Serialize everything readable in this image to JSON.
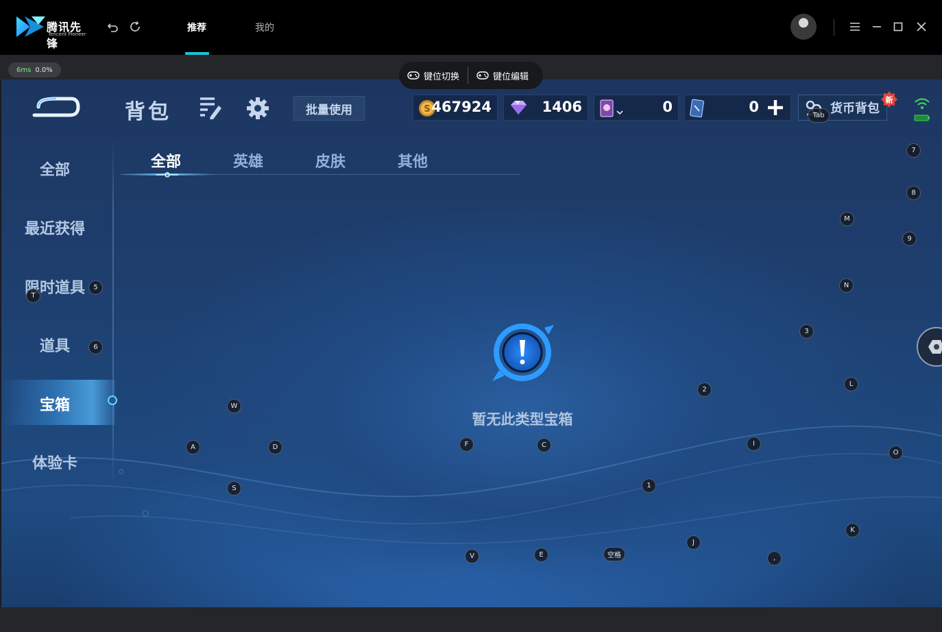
{
  "titlebar": {
    "logo_cn": "腾讯先锋",
    "logo_en": "Tencent Pioneer",
    "nav": [
      {
        "label": "推荐",
        "active": true
      },
      {
        "label": "我的",
        "active": false
      }
    ],
    "accent_color": "#19c4d9"
  },
  "perf": {
    "latency": "6ms",
    "loss": "0.0%"
  },
  "keybar": {
    "switch_label": "键位切换",
    "edit_label": "键位编辑"
  },
  "game": {
    "title": "背包",
    "batch_use": "批量使用",
    "currencies": [
      "467924",
      "1406",
      "0",
      "0"
    ],
    "wallet_label": "货币背包",
    "new_badge": "新",
    "side_menu": [
      {
        "label": "全部",
        "active": false
      },
      {
        "label": "最近获得",
        "active": false
      },
      {
        "label": "限时道具",
        "active": false
      },
      {
        "label": "道具",
        "active": false
      },
      {
        "label": "宝箱",
        "active": true
      },
      {
        "label": "体验卡",
        "active": false
      }
    ],
    "tabs": [
      {
        "label": "全部",
        "active": true
      },
      {
        "label": "英雄",
        "active": false
      },
      {
        "label": "皮肤",
        "active": false
      },
      {
        "label": "其他",
        "active": false
      }
    ],
    "empty_text": "暂无此类型宝箱"
  },
  "key_hints": {
    "tab": "Tab",
    "k7": "7",
    "k8": "8",
    "m": "M",
    "k9": "9",
    "k5": "5",
    "t": "T",
    "n": "N",
    "k3": "3",
    "k6": "6",
    "k2": "2",
    "l": "L",
    "w": "W",
    "a": "A",
    "d": "D",
    "f": "F",
    "c": "C",
    "i": "I",
    "o": "O",
    "k1": "1",
    "s": "S",
    "k": "K",
    "j": "J",
    "v": "V",
    "e": "E",
    "space": "空格",
    "comma": ","
  }
}
